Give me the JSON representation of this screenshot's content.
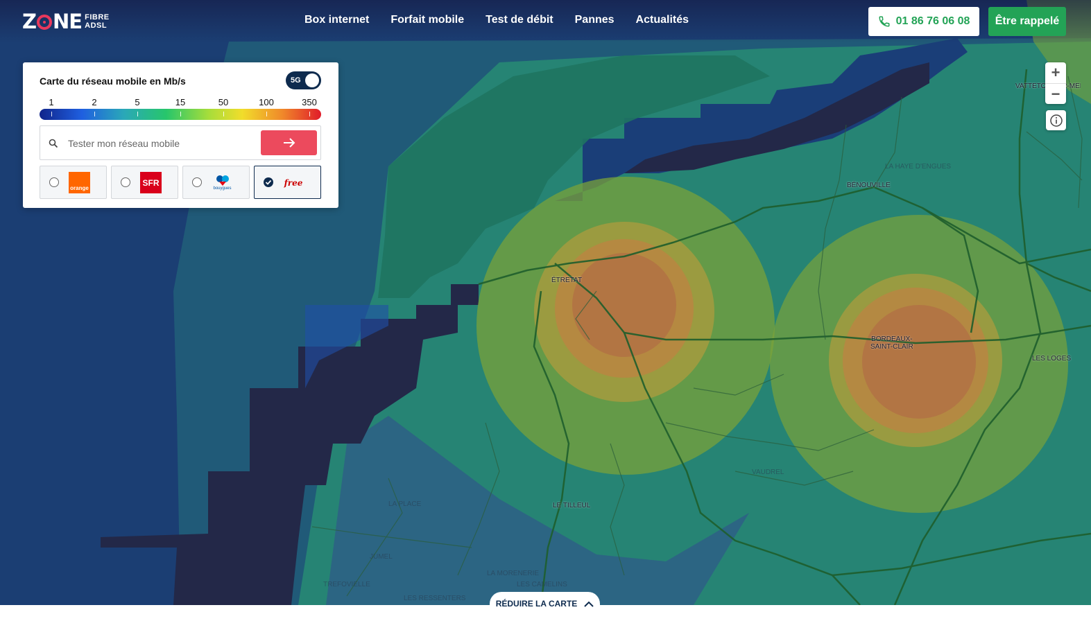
{
  "header": {
    "logo_main": "ZONE",
    "logo_sub_line1": "FIBRE",
    "logo_sub_line2": "ADSL",
    "nav": [
      {
        "label": "Box internet"
      },
      {
        "label": "Forfait mobile"
      },
      {
        "label": "Test de débit"
      },
      {
        "label": "Pannes"
      },
      {
        "label": "Actualités"
      }
    ],
    "phone_number": "01 86 76 06 08",
    "callback_label": "Être rappelé"
  },
  "panel": {
    "title": "Carte du réseau mobile en Mb/s",
    "toggle_label": "5G",
    "toggle_on": true,
    "scale_labels": [
      "1",
      "2",
      "5",
      "15",
      "50",
      "100",
      "350"
    ],
    "search_placeholder": "Tester mon réseau mobile",
    "operators": [
      {
        "name": "orange",
        "logo_text": "orange",
        "selected": false
      },
      {
        "name": "sfr",
        "logo_text": "SFR",
        "selected": false
      },
      {
        "name": "bouygues",
        "logo_text": "bouygues",
        "selected": false
      },
      {
        "name": "free",
        "logo_text": "free",
        "selected": true
      }
    ]
  },
  "map": {
    "zoom_in_label": "+",
    "zoom_out_label": "−",
    "places": [
      {
        "name": "ÉTRETAT",
        "faint": false
      },
      {
        "name": "BÉNOUVILLE",
        "faint": false
      },
      {
        "name": "LA HAYE D'ENGUES",
        "faint": true
      },
      {
        "name": "BORDEAUX-\nSAINT-CLAIR",
        "faint": false
      },
      {
        "name": "LES LOGES",
        "faint": false
      },
      {
        "name": "VATTETOT-SUR-MER",
        "faint": false
      },
      {
        "name": "LE TILLEUL",
        "faint": false
      },
      {
        "name": "VAUDREL",
        "faint": true
      },
      {
        "name": "LA PLACE",
        "faint": true
      },
      {
        "name": "JUMEL",
        "faint": true
      },
      {
        "name": "LA MORENERIE",
        "faint": true
      },
      {
        "name": "LES CAMELINS",
        "faint": true
      },
      {
        "name": "TREFOVIELLE",
        "faint": true
      },
      {
        "name": "LES RESSENTERS",
        "faint": true
      }
    ]
  },
  "reduce_label": "RÉDUIRE LA CARTE"
}
